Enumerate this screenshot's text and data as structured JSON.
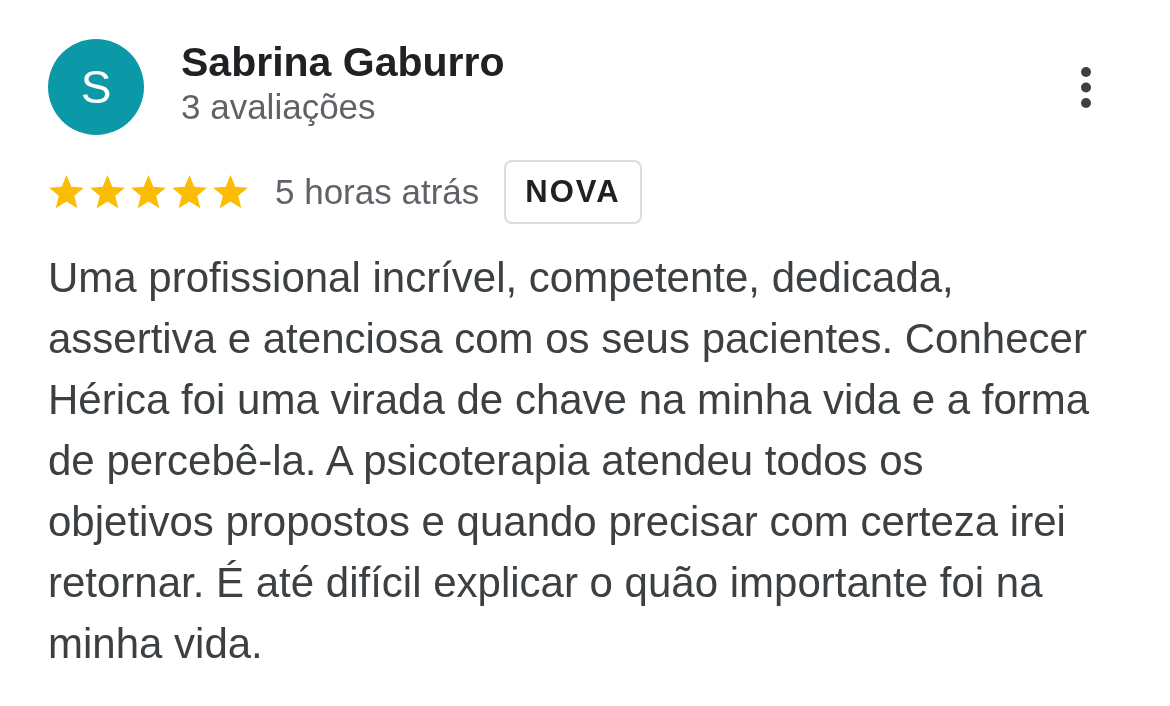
{
  "reviewer": {
    "initial": "S",
    "name": "Sabrina Gaburro",
    "review_count": "3 avaliações"
  },
  "rating": {
    "stars": 5
  },
  "time": "5 horas atrás",
  "badge": "NOVA",
  "text": "Uma profissional incrível, competente, dedicada, assertiva e atenciosa com os seus pacientes. Conhecer Hérica foi uma virada de chave na minha vida e a forma de percebê-la. A psicoterapia atendeu todos os objetivos propostos e quando precisar com certeza irei retornar. É até difícil explicar o quão importante foi na minha vida."
}
